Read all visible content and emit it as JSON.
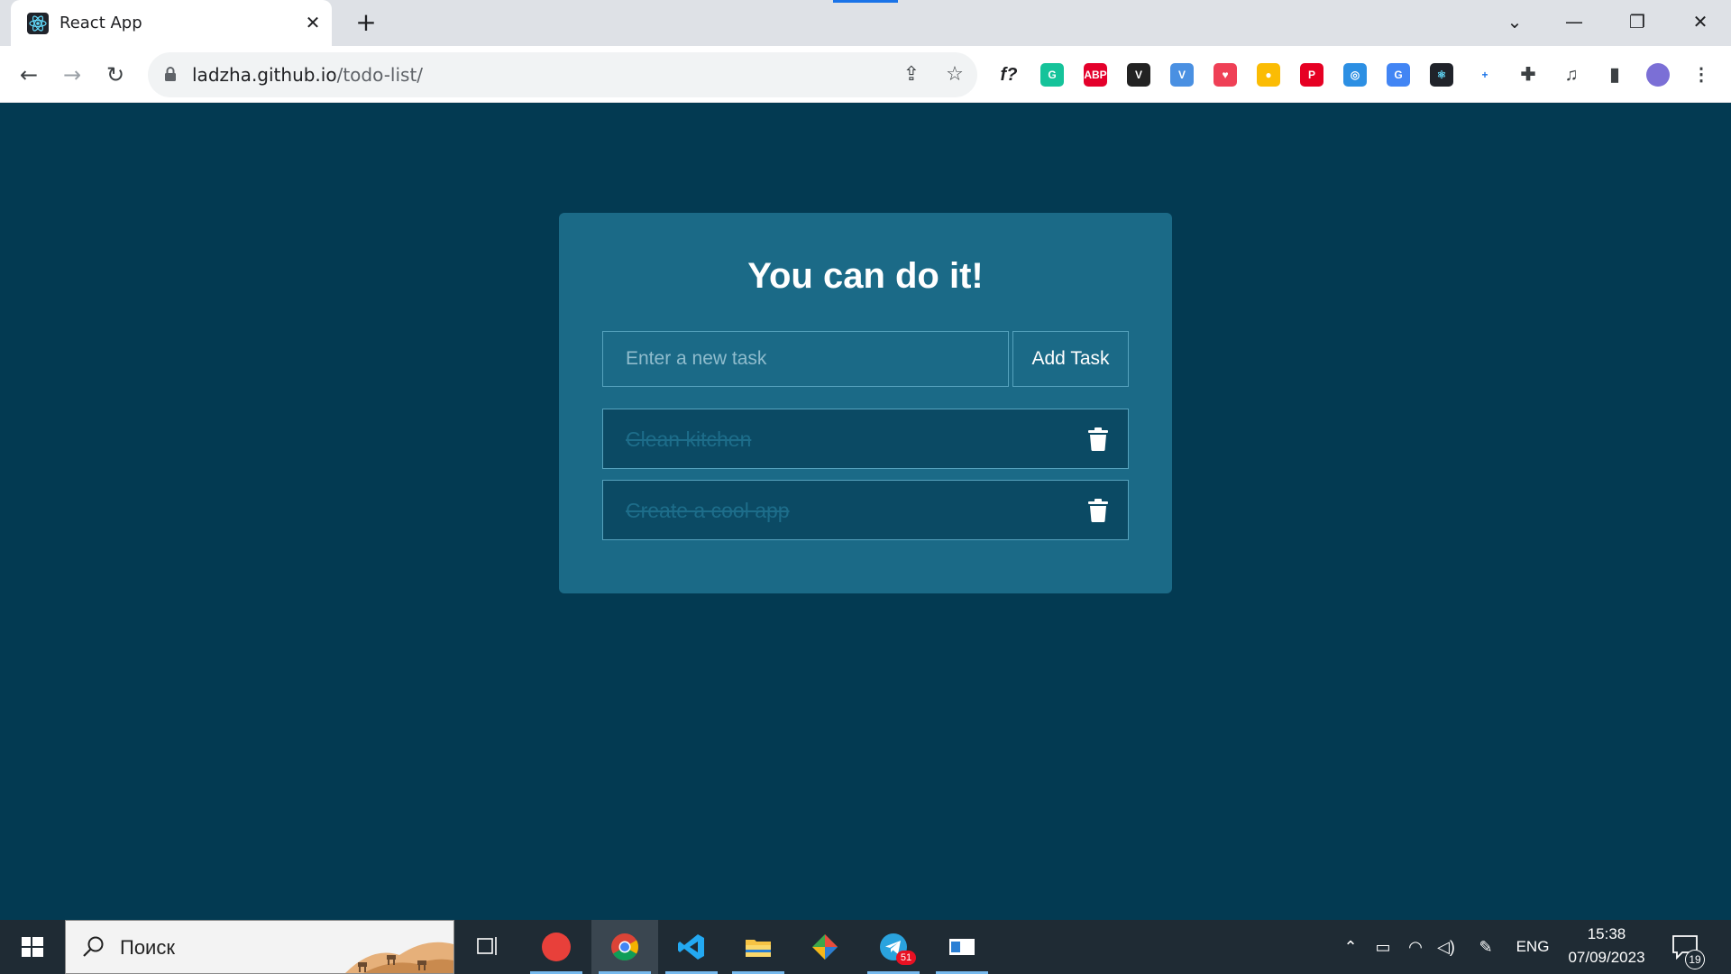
{
  "browser": {
    "tab_title": "React App",
    "url_host": "ladzha.github.io",
    "url_path": "/todo-list/",
    "extensions": [
      {
        "name": "formula",
        "label": "f?",
        "color": "#ffffff",
        "text_color": "#202124"
      },
      {
        "name": "grammarly",
        "label": "G",
        "color": "#15c39a"
      },
      {
        "name": "adblock-plus",
        "label": "ABP",
        "color": "#e4002b"
      },
      {
        "name": "v-dark",
        "label": "V",
        "color": "#222222"
      },
      {
        "name": "v-blue",
        "label": "V",
        "color": "#4a90e2"
      },
      {
        "name": "pocket",
        "label": "♥",
        "color": "#ef4056"
      },
      {
        "name": "keep",
        "label": "●",
        "color": "#fbbc04"
      },
      {
        "name": "pinterest",
        "label": "P",
        "color": "#e60023"
      },
      {
        "name": "ring",
        "label": "◎",
        "color": "#2c8fe3"
      },
      {
        "name": "translate",
        "label": "G",
        "color": "#4285f4"
      },
      {
        "name": "react-devtools",
        "label": "⚛",
        "color": "#20232a",
        "text_color": "#61dafb"
      },
      {
        "name": "cast",
        "label": "+",
        "color": "#ffffff",
        "text_color": "#1a73e8"
      },
      {
        "name": "extensions-puzzle",
        "label": "✚",
        "color": "#ffffff",
        "text_color": "#3c4043"
      },
      {
        "name": "media-queue",
        "label": "♫",
        "color": "#ffffff",
        "text_color": "#3c4043"
      },
      {
        "name": "side-panel",
        "label": "▮",
        "color": "#ffffff",
        "text_color": "#3c4043"
      },
      {
        "name": "profile-avatar",
        "label": "",
        "color": "#7b6fd6"
      },
      {
        "name": "menu-kebab",
        "label": "⋮",
        "color": "#ffffff",
        "text_color": "#3c4043"
      }
    ]
  },
  "app": {
    "title": "You can do it!",
    "input_placeholder": "Enter a new task",
    "add_button": "Add Task",
    "tasks": [
      {
        "text": "Clean kitchen",
        "completed": true
      },
      {
        "text": "Create a cool app",
        "completed": true
      }
    ],
    "colors": {
      "background": "#033a52",
      "card": "#1b6a87",
      "task_bg": "#0b4a64",
      "border": "#56a2bd"
    }
  },
  "taskbar": {
    "search_placeholder": "Поиск",
    "language": "ENG",
    "time": "15:38",
    "date": "07/09/2023",
    "notifications": "19",
    "telegram_badge": "51"
  }
}
